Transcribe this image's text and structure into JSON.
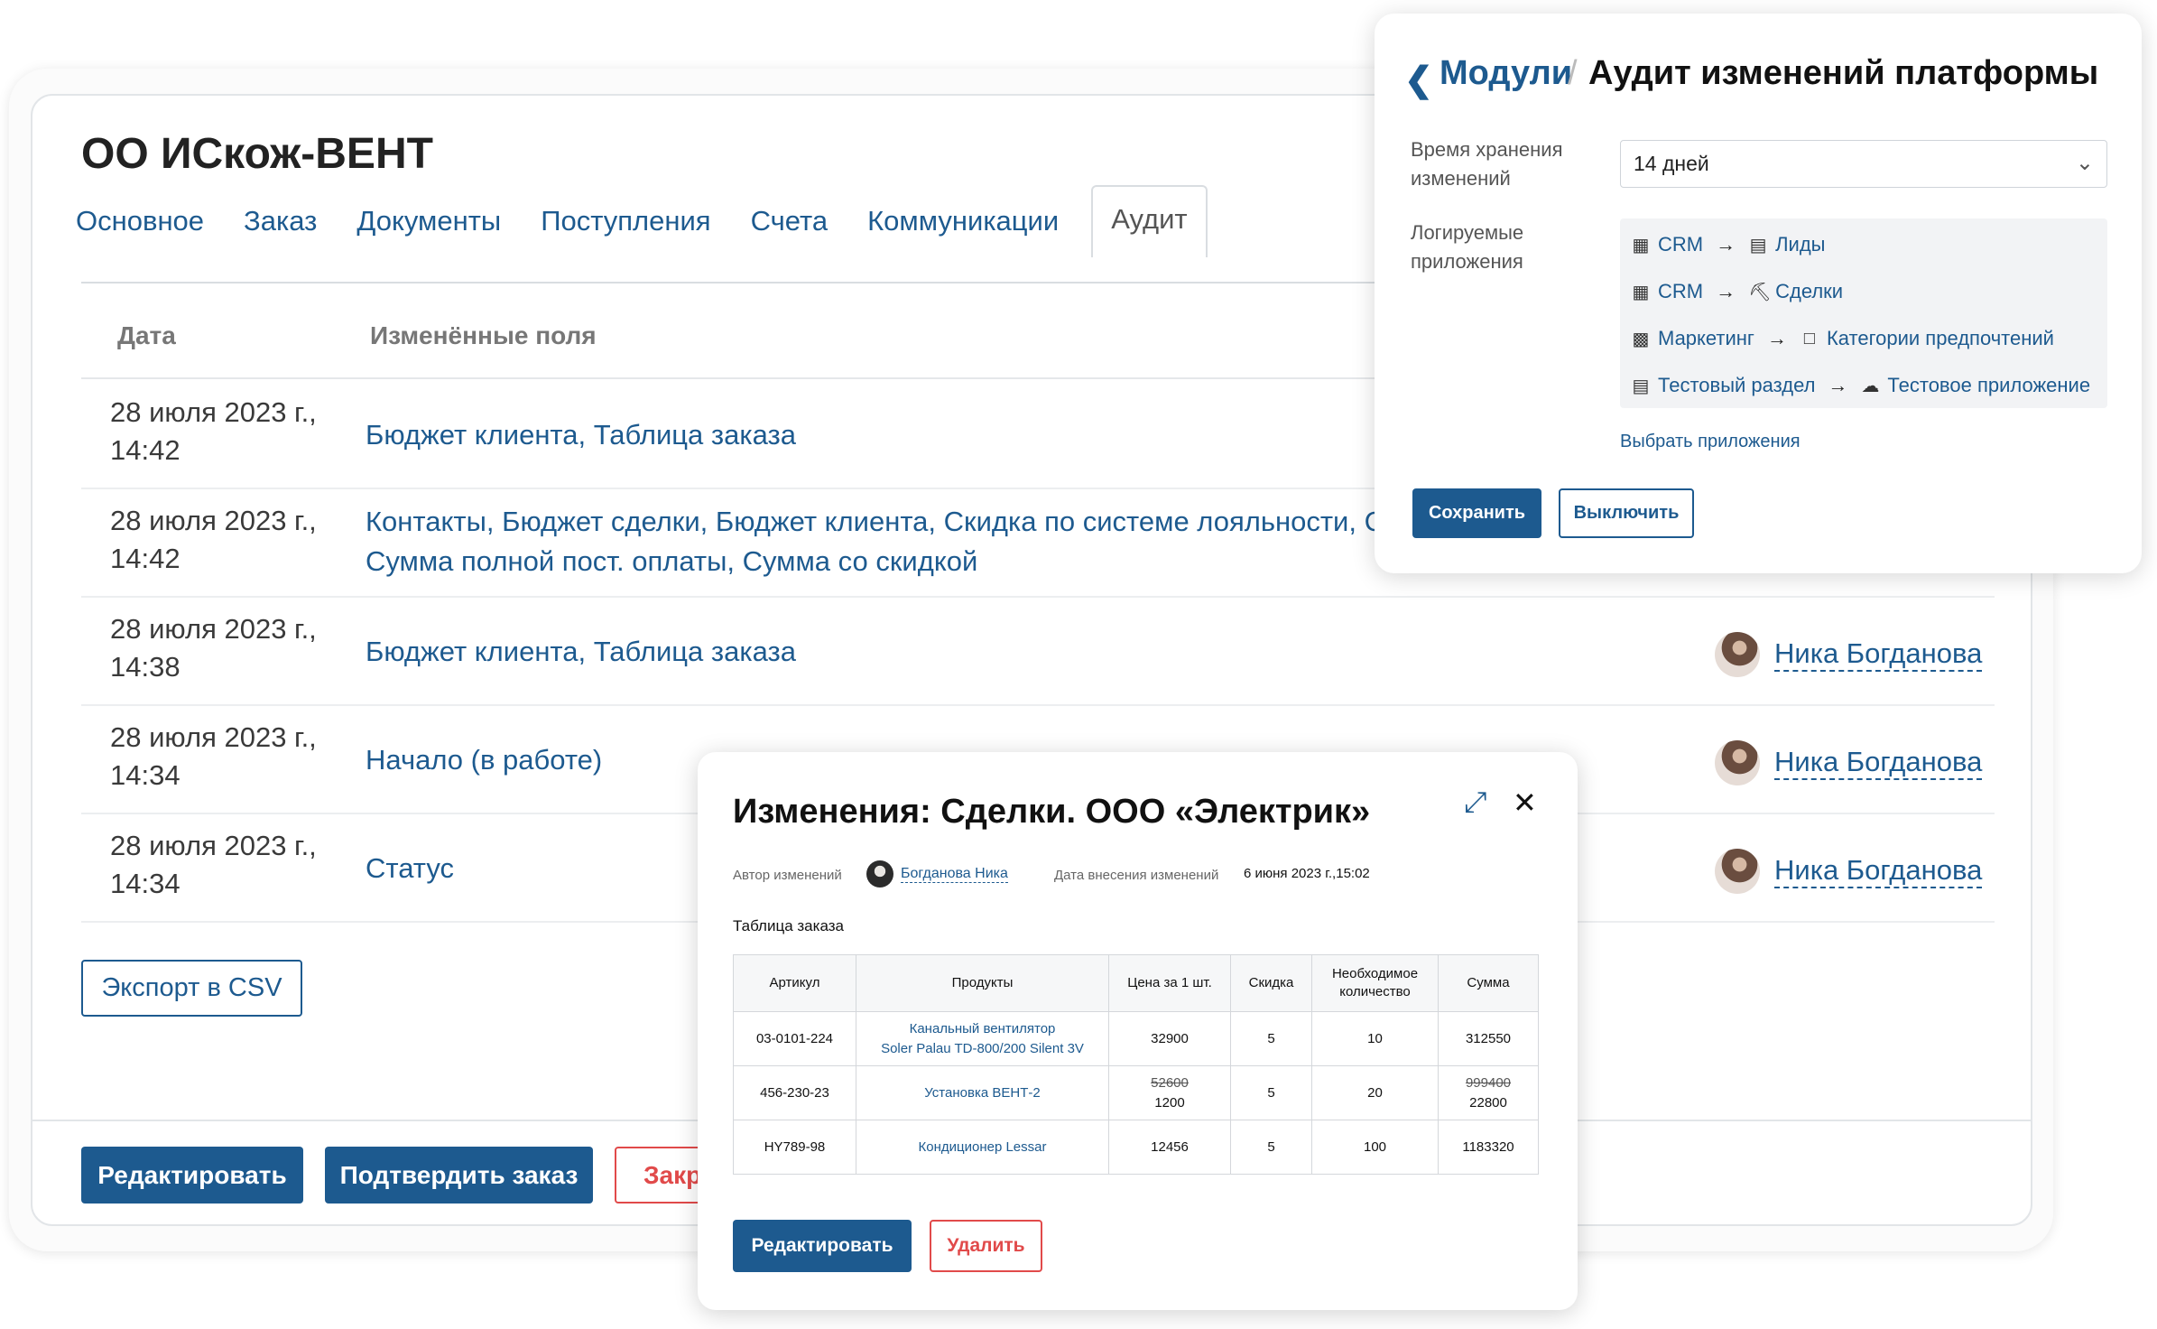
{
  "main": {
    "company": "ОО ИСкож-ВЕНТ",
    "tabs": [
      "Основное",
      "Заказ",
      "Документы",
      "Поступления",
      "Счета",
      "Коммуникации",
      "Аудит"
    ],
    "active_tab": "Аудит",
    "columns": {
      "date": "Дата",
      "fields": "Изменённые поля"
    },
    "rows": [
      {
        "date": "28 июля 2023 г.,",
        "time": "14:42",
        "fields": "Бюджет клиента, Таблица заказа",
        "user": ""
      },
      {
        "date": "28 июля 2023 г.,",
        "time": "14:42",
        "fields": "Контакты, Бюджет сделки, Бюджет клиента, Скидка по системе лояльности, Схема с",
        "fields2": "Сумма полной пост. оплаты, Сумма со скидкой",
        "user": ""
      },
      {
        "date": "28 июля 2023 г.,",
        "time": "14:38",
        "fields": "Бюджет клиента, Таблица заказа",
        "user": "Ника Богданова"
      },
      {
        "date": "28 июля 2023 г.,",
        "time": "14:34",
        "fields": "Начало (в работе)",
        "user": "Ника Богданова"
      },
      {
        "date": "28 июля 2023 г.,",
        "time": "14:34",
        "fields": "Статус",
        "user": "Ника Богданова"
      }
    ],
    "export_label": "Экспорт в CSV",
    "footer": {
      "edit": "Редактировать",
      "confirm": "Подтвердить заказ",
      "close": "Закр"
    }
  },
  "audit_settings": {
    "back_icon": "chevron-left-icon",
    "breadcrumb_root": "Модули",
    "separator": "/",
    "title": "Аудит изменений платформы",
    "retention_label": "Время хранения изменений",
    "retention_value": "14 дней",
    "apps_label": "Логируемые приложения",
    "apps": [
      {
        "from": "CRM",
        "from_icon": "contact-card-icon",
        "to": "Лиды",
        "to_icon": "id-card-icon"
      },
      {
        "from": "CRM",
        "from_icon": "contact-card-icon",
        "to": "Сделки",
        "to_icon": "coins-icon"
      },
      {
        "from": "Маркетинг",
        "from_icon": "chart-icon",
        "to": "Категории предпочтений",
        "to_icon": "folder-icon"
      },
      {
        "from": "Тестовый раздел",
        "from_icon": "archive-icon",
        "to": "Тестовое приложение",
        "to_icon": "cloud-icon"
      }
    ],
    "choose_apps": "Выбрать приложения",
    "save": "Сохранить",
    "disable": "Выключить"
  },
  "changes_modal": {
    "title": "Изменения: Сделки. ООО «Электрик»",
    "author_label": "Автор изменений",
    "author": "Богданова Ника",
    "date_label": "Дата внесения изменений",
    "date": "6 июня 2023 г.,15:02",
    "table_label": "Таблица заказа",
    "headers": [
      "Артикул",
      "Продукты",
      "Цена за 1 шт.",
      "Скидка",
      "Необходимое количество",
      "Сумма"
    ],
    "rows": [
      {
        "sku": "03-0101-224",
        "product": "Канальный вентилятор",
        "product2": "Soler Palau TD-800/200 Silent 3V",
        "price_old": "",
        "price": "32900",
        "discount": "5",
        "qty": "10",
        "sum_old": "",
        "sum": "312550"
      },
      {
        "sku": "456-230-23",
        "product": "Установка ВЕНТ-2",
        "product2": "",
        "price_old": "52600",
        "price": "1200",
        "discount": "5",
        "qty": "20",
        "sum_old": "999400",
        "sum": "22800"
      },
      {
        "sku": "HY789-98",
        "product": "Кондиционер Lessar",
        "product2": "",
        "price_old": "",
        "price": "12456",
        "discount": "5",
        "qty": "100",
        "sum_old": "",
        "sum": "1183320"
      }
    ],
    "edit": "Редактировать",
    "delete": "Удалить"
  },
  "colors": {
    "accent": "#1d5a8f",
    "danger": "#e14a4a"
  }
}
